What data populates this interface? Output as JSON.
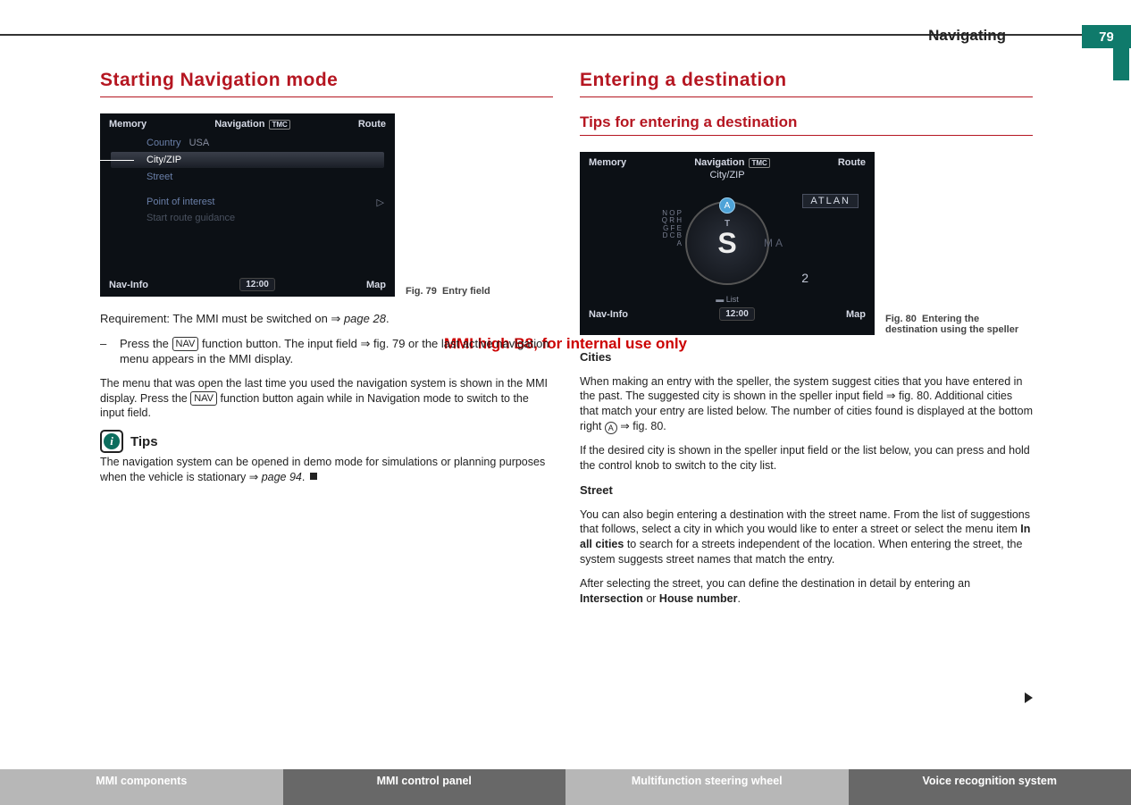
{
  "header": {
    "section": "Navigating",
    "page": "79"
  },
  "watermark": "MMI high B8, for internal use only",
  "left": {
    "heading": "Starting Navigation mode",
    "fig79": {
      "num": "Fig. 79",
      "caption": "Entry field",
      "top_left": "Memory",
      "top_mid": "Navigation",
      "top_mid_badge": "TMC",
      "top_right": "Route",
      "lines": {
        "country_label": "Country",
        "country_value": "USA",
        "cityzip": "City/ZIP",
        "street": "Street",
        "poi": "Point of interest",
        "start": "Start route guidance"
      },
      "bottom_left": "Nav-Info",
      "clock": "12:00",
      "bottom_right": "Map"
    },
    "para1_a": "Requirement: The MMI must be switched on ⇒ ",
    "para1_link": "page 28",
    "para1_b": ".",
    "bullet_a": "Press the ",
    "bullet_nav": "NAV",
    "bullet_b": " function button. The input field ⇒ fig. 79 or the last active navigation menu appears in the MMI display.",
    "para2_a": "The menu that was open the last time you used the navigation system is shown in the MMI display. Press the ",
    "para2_nav": "NAV",
    "para2_b": " function button again while in Navigation mode to switch to the input field.",
    "tips_label": "Tips",
    "tips_body_a": "The navigation system can be opened in demo mode for simulations or planning purposes when the vehicle is stationary ⇒ ",
    "tips_link": "page 94",
    "tips_body_b": "."
  },
  "right": {
    "heading": "Entering a destination",
    "subheading": "Tips for entering a destination",
    "fig80": {
      "num": "Fig. 80",
      "caption": "Entering the destination using the speller",
      "top_left": "Memory",
      "top_mid": "Navigation",
      "top_mid_badge": "TMC",
      "top_right": "Route",
      "city_label": "City/ZIP",
      "input_value": "ATLAN",
      "big_letter": "S",
      "sel_letter": "A",
      "next_letter": "T",
      "arc_letters": "N O P Q R\nH G F E D C B A",
      "right_letters": "MA",
      "count": "2",
      "bottom_left": "Nav-Info",
      "clock": "12:00",
      "bottom_right": "Map",
      "list_label": "List"
    },
    "cities_head": "Cities",
    "cities_body": "When making an entry with the speller, the system suggest cities that you have entered in the past. The suggested city is shown in the speller input field ⇒ fig. 80. Additional cities that match your entry are listed below. The number of cities found is displayed at the bottom right ",
    "cities_body_tail": " ⇒ fig. 80.",
    "cities_body2": "If the desired city is shown in the speller input field or the list below, you can press and hold the control knob to switch to the city list.",
    "street_head": "Street",
    "street_body_a": "You can also begin entering a destination with the street name. From the list of suggestions that follows, select a city in which you would like to enter a street or select the menu item ",
    "street_bold1": "In all cities",
    "street_body_b": " to search for a streets independent of the location. When entering the street, the system suggests street names that match the entry.",
    "street_body2_a": "After selecting the street, you can define the destination in detail by entering an ",
    "street_bold2": "Intersection",
    "street_body2_b": " or ",
    "street_bold3": "House number",
    "street_body2_c": ".",
    "circle_a": "A"
  },
  "footer": {
    "t1": "MMI components",
    "t2": "MMI control panel",
    "t3": "Multifunction steering wheel",
    "t4": "Voice recognition system"
  }
}
